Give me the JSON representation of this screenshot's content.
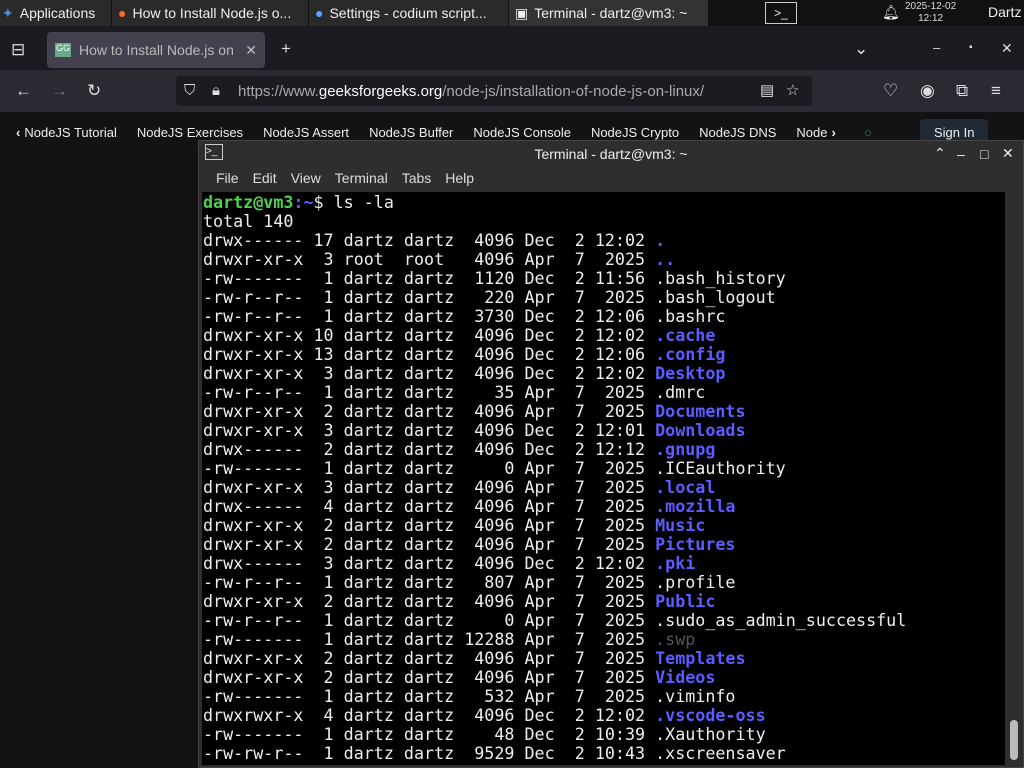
{
  "panel": {
    "apps": "Applications",
    "tasks": [
      "How to Install Node.js o...",
      "Settings - codium script...",
      "Terminal - dartz@vm3: ~"
    ],
    "date": "2025-12-02",
    "time": "12:12",
    "user": "Dartz"
  },
  "browser": {
    "tab": "How to Install Node.js on",
    "url_pre": "https://www.",
    "url_host": "geeksforgeeks.org",
    "url_path": "/node-js/installation-of-node-js-on-linux/"
  },
  "sitenav": {
    "items": [
      "NodeJS Tutorial",
      "NodeJS Exercises",
      "NodeJS Assert",
      "NodeJS Buffer",
      "NodeJS Console",
      "NodeJS Crypto",
      "NodeJS DNS",
      "Node"
    ],
    "sign_in": "Sign In"
  },
  "terminal": {
    "title": "Terminal - dartz@vm3: ~",
    "menu": [
      "File",
      "Edit",
      "View",
      "Terminal",
      "Tabs",
      "Help"
    ],
    "prompt_user": "dartz@vm3",
    "prompt_path": ":~",
    "prompt_sym": "$ ",
    "command": "ls -la",
    "total": "total 140",
    "rows": [
      {
        "meta": "drwx------ 17 dartz dartz  4096 Dec  2 12:02 ",
        "name": ".",
        "kind": "dir"
      },
      {
        "meta": "drwxr-xr-x  3 root  root   4096 Apr  7  2025 ",
        "name": "..",
        "kind": "dir"
      },
      {
        "meta": "-rw-------  1 dartz dartz  1120 Dec  2 11:56 ",
        "name": ".bash_history",
        "kind": "file"
      },
      {
        "meta": "-rw-r--r--  1 dartz dartz   220 Apr  7  2025 ",
        "name": ".bash_logout",
        "kind": "file"
      },
      {
        "meta": "-rw-r--r--  1 dartz dartz  3730 Dec  2 12:06 ",
        "name": ".bashrc",
        "kind": "file"
      },
      {
        "meta": "drwxr-xr-x 10 dartz dartz  4096 Dec  2 12:02 ",
        "name": ".cache",
        "kind": "dir"
      },
      {
        "meta": "drwxr-xr-x 13 dartz dartz  4096 Dec  2 12:06 ",
        "name": ".config",
        "kind": "dir"
      },
      {
        "meta": "drwxr-xr-x  3 dartz dartz  4096 Dec  2 12:02 ",
        "name": "Desktop",
        "kind": "dir"
      },
      {
        "meta": "-rw-r--r--  1 dartz dartz    35 Apr  7  2025 ",
        "name": ".dmrc",
        "kind": "file"
      },
      {
        "meta": "drwxr-xr-x  2 dartz dartz  4096 Apr  7  2025 ",
        "name": "Documents",
        "kind": "dir"
      },
      {
        "meta": "drwxr-xr-x  3 dartz dartz  4096 Dec  2 12:01 ",
        "name": "Downloads",
        "kind": "dir"
      },
      {
        "meta": "drwx------  2 dartz dartz  4096 Dec  2 12:12 ",
        "name": ".gnupg",
        "kind": "dir"
      },
      {
        "meta": "-rw-------  1 dartz dartz     0 Apr  7  2025 ",
        "name": ".ICEauthority",
        "kind": "file"
      },
      {
        "meta": "drwxr-xr-x  3 dartz dartz  4096 Apr  7  2025 ",
        "name": ".local",
        "kind": "dir"
      },
      {
        "meta": "drwx------  4 dartz dartz  4096 Apr  7  2025 ",
        "name": ".mozilla",
        "kind": "dir"
      },
      {
        "meta": "drwxr-xr-x  2 dartz dartz  4096 Apr  7  2025 ",
        "name": "Music",
        "kind": "dir"
      },
      {
        "meta": "drwxr-xr-x  2 dartz dartz  4096 Apr  7  2025 ",
        "name": "Pictures",
        "kind": "dir"
      },
      {
        "meta": "drwx------  3 dartz dartz  4096 Dec  2 12:02 ",
        "name": ".pki",
        "kind": "dir"
      },
      {
        "meta": "-rw-r--r--  1 dartz dartz   807 Apr  7  2025 ",
        "name": ".profile",
        "kind": "file"
      },
      {
        "meta": "drwxr-xr-x  2 dartz dartz  4096 Apr  7  2025 ",
        "name": "Public",
        "kind": "dir"
      },
      {
        "meta": "-rw-r--r--  1 dartz dartz     0 Apr  7  2025 ",
        "name": ".sudo_as_admin_successful",
        "kind": "file"
      },
      {
        "meta": "-rw-------  1 dartz dartz 12288 Apr  7  2025 ",
        "name": ".swp",
        "kind": "swp"
      },
      {
        "meta": "drwxr-xr-x  2 dartz dartz  4096 Apr  7  2025 ",
        "name": "Templates",
        "kind": "dir"
      },
      {
        "meta": "drwxr-xr-x  2 dartz dartz  4096 Apr  7  2025 ",
        "name": "Videos",
        "kind": "dir"
      },
      {
        "meta": "-rw-------  1 dartz dartz   532 Apr  7  2025 ",
        "name": ".viminfo",
        "kind": "file"
      },
      {
        "meta": "drwxrwxr-x  4 dartz dartz  4096 Dec  2 12:02 ",
        "name": ".vscode-oss",
        "kind": "dir"
      },
      {
        "meta": "-rw-------  1 dartz dartz    48 Dec  2 10:39 ",
        "name": ".Xauthority",
        "kind": "file"
      },
      {
        "meta": "-rw-rw-r--  1 dartz dartz  9529 Dec  2 10:43 ",
        "name": ".xscreensaver",
        "kind": "file"
      }
    ]
  },
  "colors": {
    "dir": "#5c5cff",
    "prompt": "#4ed34e",
    "swp": "#555555"
  }
}
